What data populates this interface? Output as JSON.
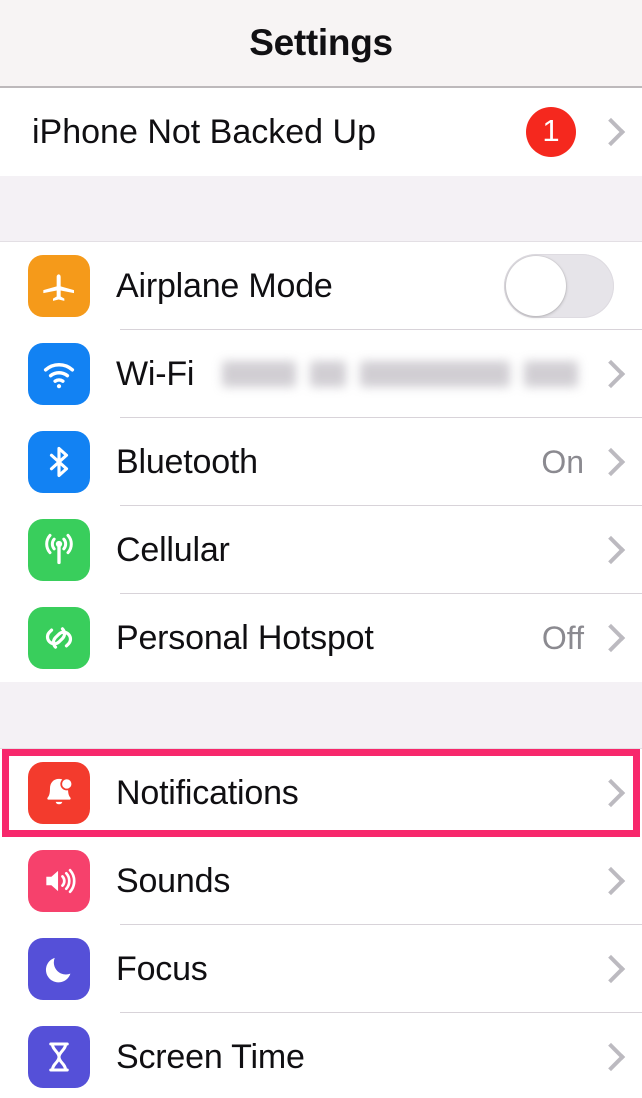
{
  "navbar": {
    "title": "Settings"
  },
  "groups": [
    {
      "id": "backup-group",
      "rows": [
        {
          "name": "iphone-not-backed-up",
          "label": "iPhone Not Backed Up",
          "badge": "1",
          "accessory": "chevron",
          "icon": null
        }
      ]
    },
    {
      "id": "connectivity-group",
      "rows": [
        {
          "name": "airplane-mode",
          "label": "Airplane Mode",
          "icon": "airplane-icon",
          "icon_color": "#F59A1A",
          "accessory": "toggle",
          "toggle_state": "off"
        },
        {
          "name": "wifi",
          "label": "Wi-Fi",
          "icon": "wifi-icon",
          "icon_color": "#1282F3",
          "value": "",
          "value_redacted": true,
          "accessory": "chevron"
        },
        {
          "name": "bluetooth",
          "label": "Bluetooth",
          "icon": "bluetooth-icon",
          "icon_color": "#1282F3",
          "value": "On",
          "accessory": "chevron"
        },
        {
          "name": "cellular",
          "label": "Cellular",
          "icon": "cellular-antenna-icon",
          "icon_color": "#39CE5C",
          "value": "",
          "accessory": "chevron"
        },
        {
          "name": "personal-hotspot",
          "label": "Personal Hotspot",
          "icon": "hotspot-link-icon",
          "icon_color": "#39CE5C",
          "value": "Off",
          "accessory": "chevron"
        }
      ]
    },
    {
      "id": "system-group",
      "rows": [
        {
          "name": "notifications",
          "label": "Notifications",
          "icon": "bell-icon",
          "icon_color": "#F33B2D",
          "accessory": "chevron",
          "highlighted": true
        },
        {
          "name": "sounds",
          "label": "Sounds",
          "icon": "speaker-waves-icon",
          "icon_color": "#F6416C",
          "accessory": "chevron"
        },
        {
          "name": "focus",
          "label": "Focus",
          "icon": "moon-icon",
          "icon_color": "#5550D8",
          "accessory": "chevron"
        },
        {
          "name": "screen-time",
          "label": "Screen Time",
          "icon": "hourglass-icon",
          "icon_color": "#5550D8",
          "accessory": "chevron"
        }
      ]
    }
  ],
  "colors": {
    "highlight_ring": "#F7286C",
    "badge_red": "#F5281E",
    "nav_background": "#F7F4F4",
    "group_gap_background": "#F4F1F5",
    "row_background": "#FFFFFF",
    "separator": "#D8D3D9",
    "secondary_text": "#8B8A90",
    "primary_text": "#100F12",
    "chevron": "#BCBAC0"
  }
}
